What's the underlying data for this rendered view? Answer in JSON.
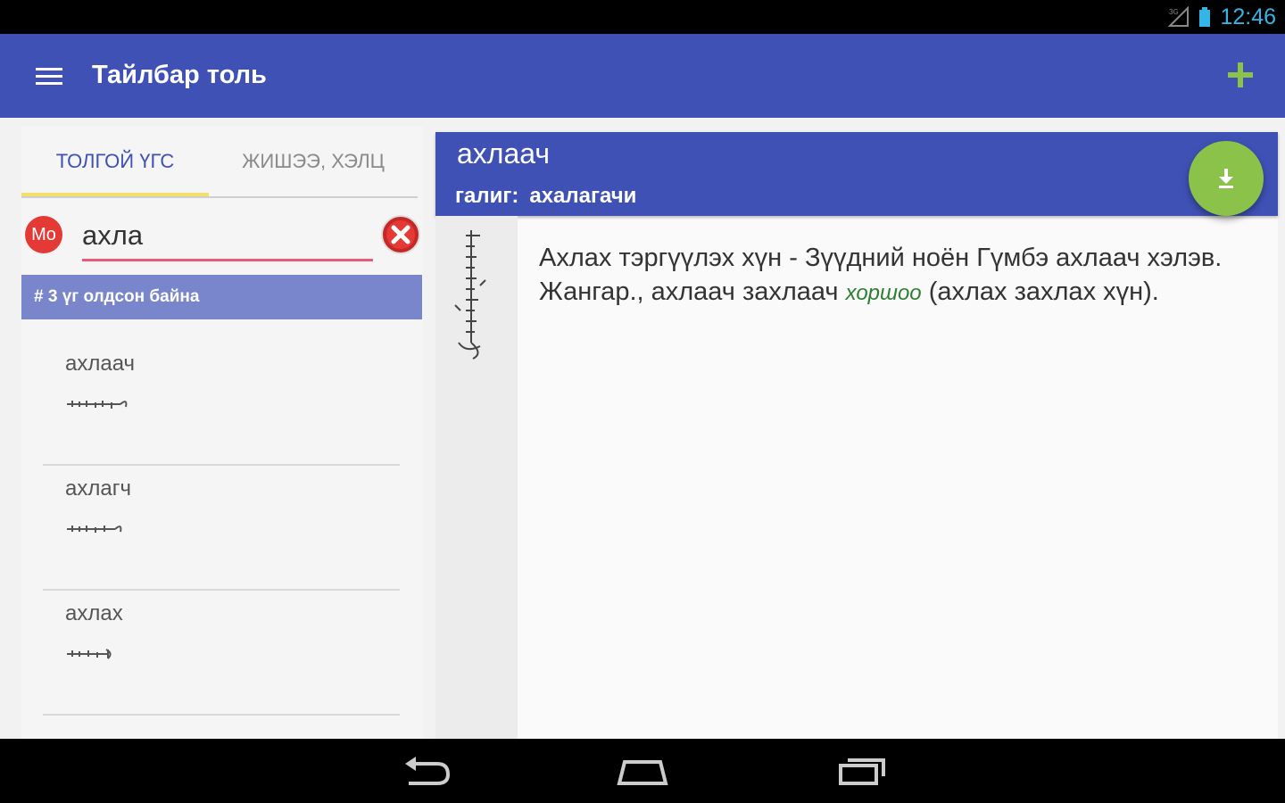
{
  "status_bar": {
    "time": "12:46",
    "signal_icon": "signal-icon",
    "battery_icon": "battery-icon"
  },
  "app_bar": {
    "title": "Тайлбар толь",
    "menu_icon": "menu-icon",
    "add_icon": "plus-icon",
    "color": "#3f51b5",
    "add_color": "#8bc34a"
  },
  "tabs": [
    {
      "label": "ТОЛГОЙ ҮГС",
      "active": true
    },
    {
      "label": "ЖИШЭЭ, ХЭЛЦ",
      "active": false
    }
  ],
  "search": {
    "lang_badge": "Mo",
    "value": "ахла",
    "clear_icon": "clear-icon"
  },
  "result_count_text": "# 3 үг олдсон байна",
  "words": [
    {
      "word": "ахлаач"
    },
    {
      "word": "ахлагч"
    },
    {
      "word": "ахлах"
    }
  ],
  "entry": {
    "word": "ахлаач",
    "galig_label": "галиг:",
    "galig_value": "ахалагачи",
    "definition_part1": "Ахлах тэргүүлэх хүн - Зүүдний ноён Гүмбэ ахлаач хэлэв. Жангар., ахлаач захлаач ",
    "definition_tag": "хоршоо",
    "definition_part2": " (ахлах захлах хүн).",
    "fab_icon": "download-icon"
  },
  "nav_bar": {
    "back_icon": "back-icon",
    "home_icon": "home-icon",
    "recents_icon": "recents-icon"
  }
}
